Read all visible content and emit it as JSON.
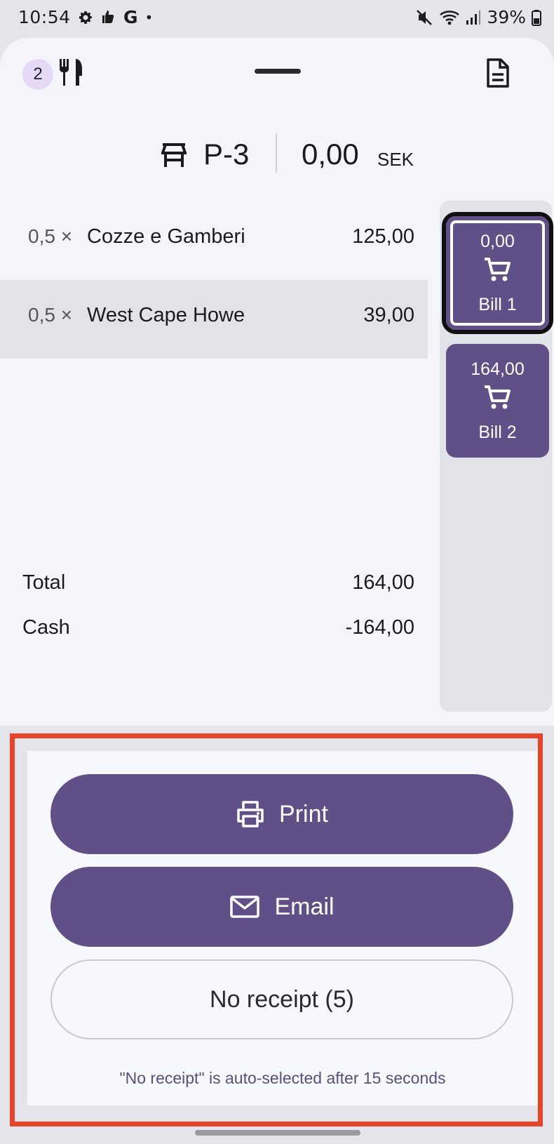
{
  "status_bar": {
    "time": "10:54",
    "google_letter": "G",
    "dot": "•",
    "battery": "39%"
  },
  "header": {
    "guest_count": "2",
    "table_name": "P-3",
    "amount": "0,00",
    "currency": "SEK"
  },
  "items": [
    {
      "qty": "0,5 ×",
      "name": "Cozze e Gamberi",
      "price": "125,00"
    },
    {
      "qty": "0,5 ×",
      "name": "West Cape Howe",
      "price": "39,00"
    }
  ],
  "summary": {
    "total_label": "Total",
    "total_value": "164,00",
    "cash_label": "Cash",
    "cash_value": "-164,00"
  },
  "bills": [
    {
      "amount": "0,00",
      "label": "Bill 1"
    },
    {
      "amount": "164,00",
      "label": "Bill 2"
    }
  ],
  "receipt": {
    "print_label": "Print",
    "email_label": "Email",
    "no_receipt_label": "No receipt (5)",
    "hint": "\"No receipt\" is auto-selected after 15 seconds"
  },
  "icons": {
    "status_left": [
      "gear-icon",
      "thumbs-icon",
      "google-icon"
    ],
    "status_right": [
      "mute-icon",
      "wifi-icon",
      "signal-icon",
      "battery-icon"
    ],
    "header": [
      "fork-knife-icon",
      "receipt-doc-icon",
      "table-icon"
    ],
    "bill": "cart-icon",
    "print": "printer-icon",
    "email": "envelope-icon"
  },
  "colors": {
    "accent": "#614f87",
    "highlight_frame": "#e8442a",
    "hint_text": "#5a4e7c",
    "guest_badge": "#e5d9f5"
  }
}
